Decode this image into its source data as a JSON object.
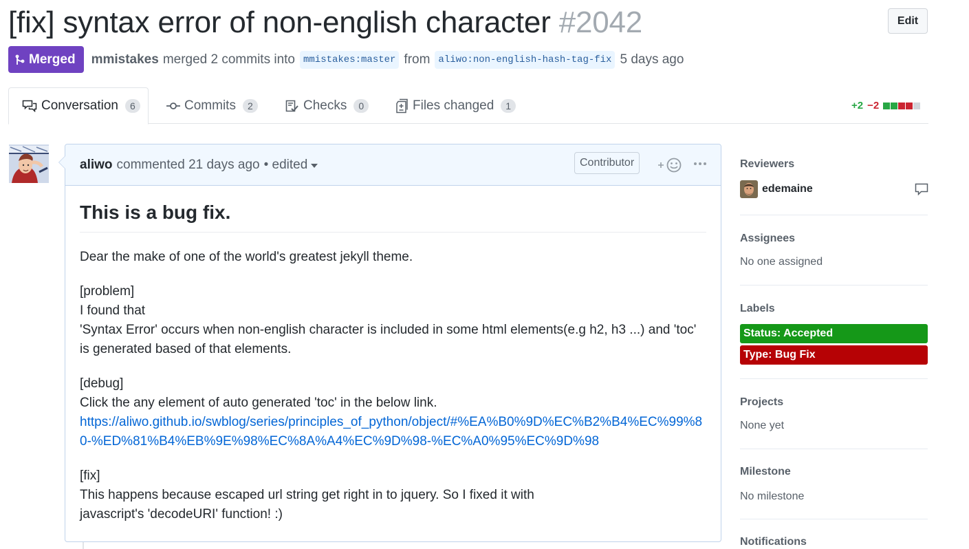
{
  "header": {
    "title": "[fix] syntax error of non-english character",
    "number": "#2042",
    "edit_label": "Edit"
  },
  "status": {
    "badge_label": "Merged",
    "badge_color": "#6f42c1",
    "author": "mmistakes",
    "action_text": "merged 2 commits into",
    "base_branch": "mmistakes:master",
    "from_text": "from",
    "head_branch": "aliwo:non-english-hash-tag-fix",
    "time": "5 days ago"
  },
  "tabs": [
    {
      "label": "Conversation",
      "count": "6",
      "icon": "comment-discussion-icon",
      "active": true
    },
    {
      "label": "Commits",
      "count": "2",
      "icon": "git-commit-icon",
      "active": false
    },
    {
      "label": "Checks",
      "count": "0",
      "icon": "checklist-icon",
      "active": false
    },
    {
      "label": "Files changed",
      "count": "1",
      "icon": "diff-icon",
      "active": false
    }
  ],
  "diffstat": {
    "additions": "+2",
    "deletions": "−2",
    "blocks": [
      "#28a745",
      "#28a745",
      "#cb2431",
      "#cb2431",
      "#d1d5da"
    ]
  },
  "comment": {
    "author": "aliwo",
    "action": "commented",
    "time": "21 days ago",
    "edited": "• edited",
    "role": "Contributor",
    "heading": "This is a bug fix.",
    "intro": "Dear the make of one of the world's greatest jekyll theme.",
    "problem_tag": "[problem]",
    "problem_line1": "I found that",
    "problem_line2": "'Syntax Error' occurs when non-english character is included in some html elements(e.g h2, h3 ...) and 'toc' is generated based of that elements.",
    "debug_tag": "[debug]",
    "debug_line": "Click the any element of auto generated 'toc' in the below link.",
    "debug_link": "https://aliwo.github.io/swblog/series/principles_of_python/object/#%EA%B0%9D%EC%B2%B4%EC%99%80-%ED%81%B4%EB%9E%98%EC%8A%A4%EC%9D%98-%EC%A0%95%EC%9D%98",
    "fix_tag": "[fix]",
    "fix_line1": "This happens because escaped url string get right in to jquery. So I fixed it with",
    "fix_line2": "javascript's 'decodeURI' function! :)"
  },
  "sidebar": {
    "reviewers_title": "Reviewers",
    "reviewer_name": "edemaine",
    "assignees_title": "Assignees",
    "assignees_value": "No one assigned",
    "labels_title": "Labels",
    "labels": [
      {
        "text": "Status: Accepted",
        "color": "#159818"
      },
      {
        "text": "Type: Bug Fix",
        "color": "#b60205"
      }
    ],
    "projects_title": "Projects",
    "projects_value": "None yet",
    "milestone_title": "Milestone",
    "milestone_value": "No milestone",
    "notifications_title": "Notifications"
  }
}
